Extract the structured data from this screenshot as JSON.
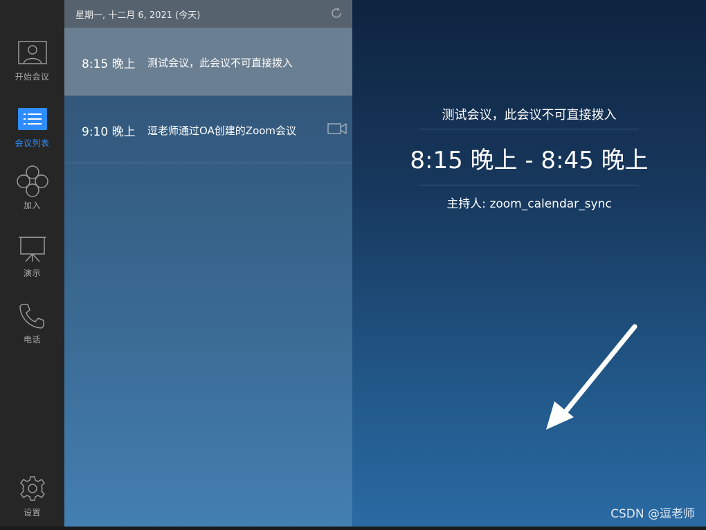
{
  "sidebar": {
    "items": [
      {
        "label": "开始会议",
        "icon": "person-icon"
      },
      {
        "label": "会议列表",
        "icon": "list-icon"
      },
      {
        "label": "加入",
        "icon": "join-icon"
      },
      {
        "label": "演示",
        "icon": "projector-icon"
      },
      {
        "label": "电话",
        "icon": "phone-icon"
      }
    ],
    "settings_label": "设置",
    "active_index": 1
  },
  "list": {
    "header_date": "星期一, 十二月 6, 2021 (今天)",
    "meetings": [
      {
        "time": "8:15 晚上",
        "topic": "测试会议，此会议不可直接拨入",
        "selected": true
      },
      {
        "time": "9:10 晚上",
        "topic": "逗老师通过OA创建的Zoom会议",
        "has_video": true
      }
    ]
  },
  "detail": {
    "title": "测试会议，此会议不可直接拨入",
    "time_range": "8:15 晚上 - 8:45 晚上",
    "host": "主持人: zoom_calendar_sync"
  },
  "watermark": "CSDN @逗老师",
  "colors": {
    "accent": "#2d8cff",
    "rail": "#262626",
    "selected_row": "#6b7f92"
  }
}
